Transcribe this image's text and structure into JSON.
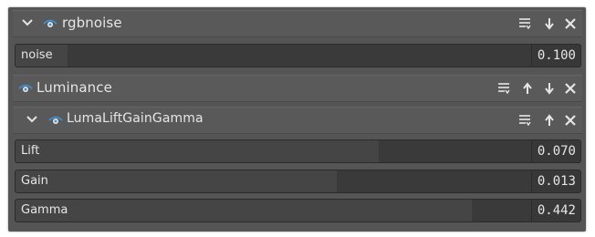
{
  "colors": {
    "panel_bg": "#555555",
    "header_bg": "#595959",
    "slider_bg": "#3a3a3a",
    "slider_fill": "#454545",
    "text": "#e6e6e6",
    "eye_blue": "#3d8fd6"
  },
  "icons": {
    "collapse": "chevron-down-icon",
    "visibility": "eye-icon",
    "menu": "menu-lines-icon",
    "move_up": "arrow-up-icon",
    "move_down": "arrow-down-icon",
    "remove": "close-icon"
  },
  "blocks": [
    {
      "name": "rgbnoise",
      "controls": [
        "menu",
        "move_down",
        "remove"
      ],
      "params": [
        {
          "label": "noise",
          "value": "0.100",
          "level": 0.1
        }
      ]
    },
    {
      "name": "Luminance",
      "controls": [
        "menu",
        "move_up",
        "move_down",
        "remove"
      ],
      "params": []
    },
    {
      "name": "LumaLiftGainGamma",
      "controls": [
        "menu",
        "move_up",
        "remove"
      ],
      "params": [
        {
          "label": "Lift",
          "value": "0.070",
          "level": 0.7
        },
        {
          "label": "Gain",
          "value": "0.013",
          "level": 0.62
        },
        {
          "label": "Gamma",
          "value": "0.442",
          "level": 0.88
        }
      ]
    }
  ]
}
